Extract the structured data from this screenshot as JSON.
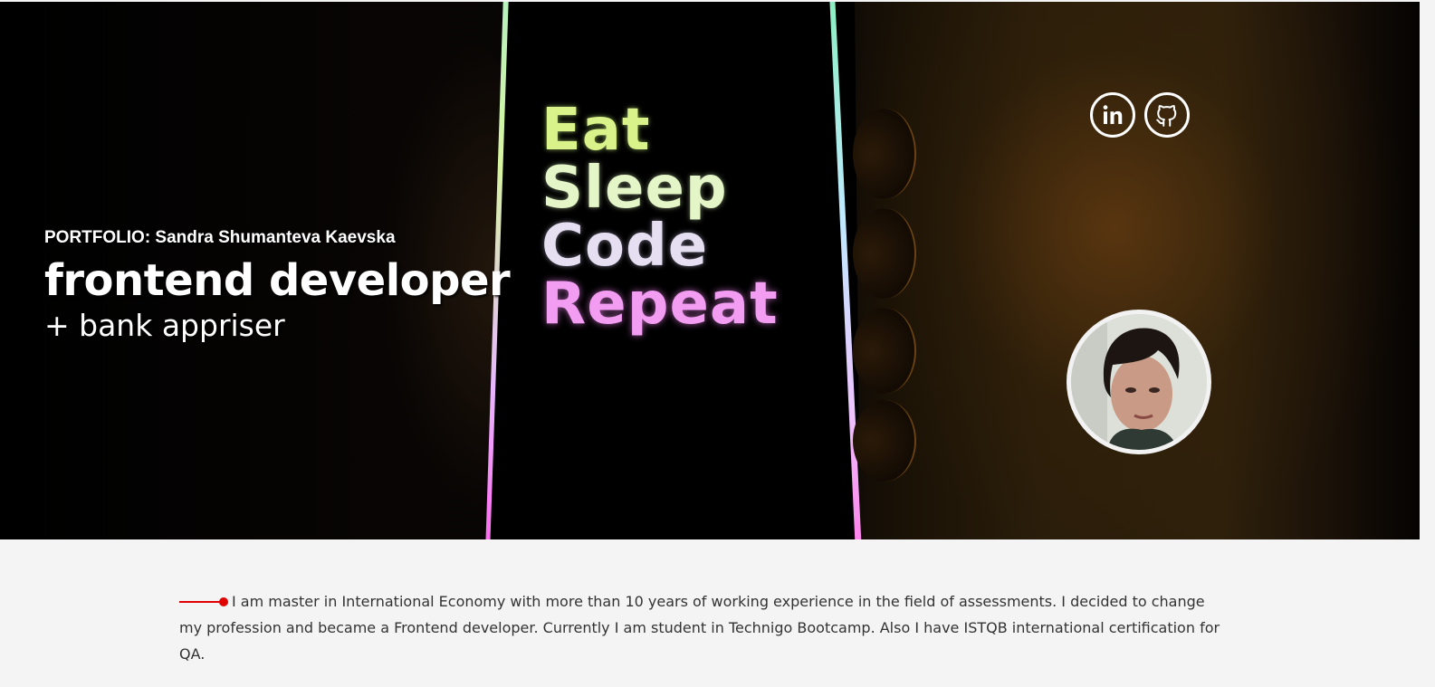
{
  "hero": {
    "kicker": "PORTFOLIO: Sandra Shumanteva Kaevska",
    "title": "frontend developer",
    "subtitle": "+ bank appriser",
    "phone_lines": [
      "Eat",
      "Sleep",
      "Code",
      "Repeat"
    ]
  },
  "socials": [
    {
      "name": "linkedin-icon",
      "label": "in"
    },
    {
      "name": "github-icon"
    }
  ],
  "about": {
    "text": "I am master in International Economy with more than 10 years of working experience in the field of assessments. I decided to change my profession and became a Frontend developer. Currently I am student in Technigo Bootcamp. Also I have ISTQB international certification for QA."
  },
  "colors": {
    "accent": "#e00000",
    "page_bg": "#f4f4f4",
    "text": "#333333"
  }
}
